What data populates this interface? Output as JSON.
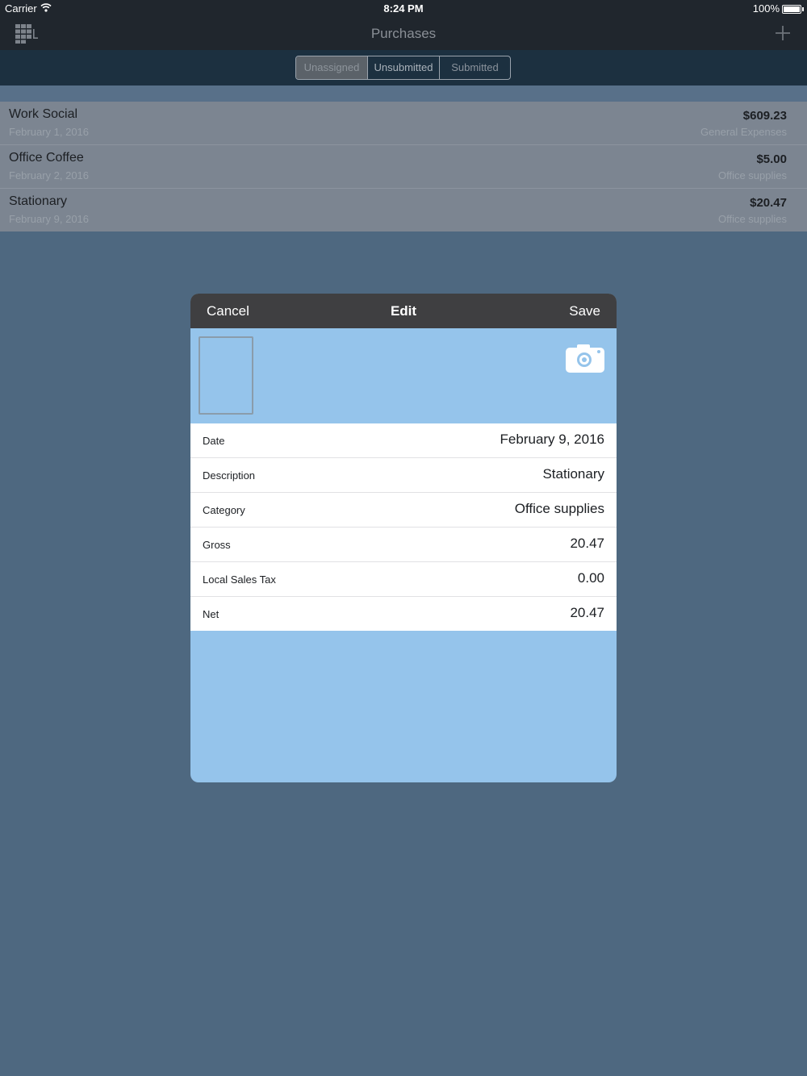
{
  "status_bar": {
    "carrier": "Carrier",
    "time": "8:24 PM",
    "battery": "100%"
  },
  "nav": {
    "title": "Purchases"
  },
  "segments": [
    {
      "label": "Unassigned",
      "selected": true
    },
    {
      "label": "Unsubmitted",
      "selected": false
    },
    {
      "label": "Submitted",
      "selected": false
    }
  ],
  "purchases": [
    {
      "title": "Work Social",
      "date": "February 1, 2016",
      "amount": "$609.23",
      "category": "General Expenses"
    },
    {
      "title": "Office Coffee",
      "date": "February 2, 2016",
      "amount": "$5.00",
      "category": "Office supplies"
    },
    {
      "title": "Stationary",
      "date": "February 9, 2016",
      "amount": "$20.47",
      "category": "Office supplies"
    }
  ],
  "modal": {
    "cancel_label": "Cancel",
    "title": "Edit",
    "save_label": "Save",
    "fields": [
      {
        "label": "Date",
        "value": "February 9, 2016"
      },
      {
        "label": "Description",
        "value": "Stationary"
      },
      {
        "label": "Category",
        "value": "Office supplies"
      },
      {
        "label": "Gross",
        "value": "20.47"
      },
      {
        "label": "Local Sales Tax",
        "value": "0.00"
      },
      {
        "label": "Net",
        "value": "20.47"
      }
    ]
  },
  "colors": {
    "bar_dark": "#20262d",
    "segment_bar": "#1c3040",
    "background": "#4e6880",
    "modal_blue": "#95c4eb",
    "modal_header": "#3f3f41"
  },
  "icons": [
    "wifi-icon",
    "battery-icon",
    "grid-icon",
    "add-icon",
    "camera-icon"
  ]
}
